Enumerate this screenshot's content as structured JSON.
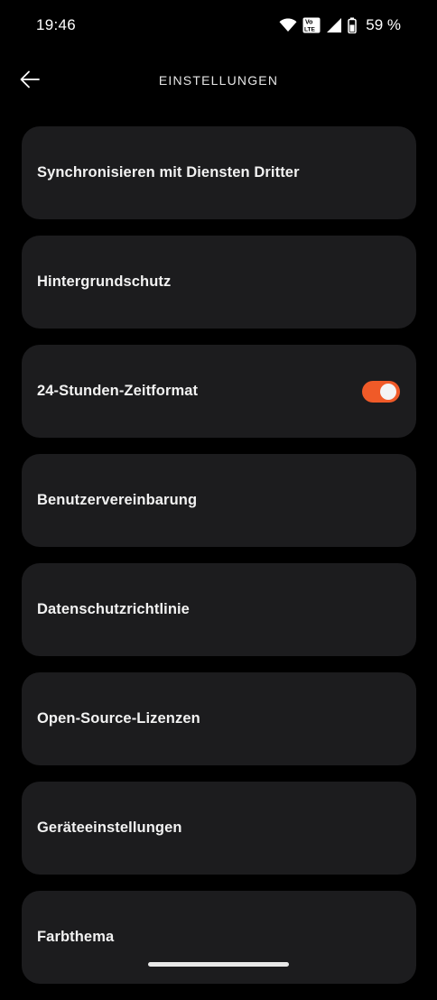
{
  "status_bar": {
    "time": "19:46",
    "battery_percent": "59 %",
    "battery_level": 0.59,
    "icons": [
      "wifi-icon",
      "volte-icon",
      "cellular-signal-icon",
      "battery-icon"
    ],
    "volte_top": "Vo",
    "volte_bottom": "LTE"
  },
  "header": {
    "title": "EINSTELLUNGEN",
    "back_icon": "back-arrow-icon"
  },
  "settings": {
    "items": [
      {
        "label": "Synchronisieren mit Diensten Dritter"
      },
      {
        "label": "Hintergrundschutz"
      },
      {
        "label": "24-Stunden-Zeitformat",
        "toggle": true
      },
      {
        "label": "Benutzervereinbarung"
      },
      {
        "label": "Datenschutzrichtlinie"
      },
      {
        "label": "Open-Source-Lizenzen"
      },
      {
        "label": "Geräteeinstellungen"
      },
      {
        "label": "Farbthema"
      }
    ]
  },
  "colors": {
    "background": "#000000",
    "card": "#1c1c1e",
    "accent": "#f05a28",
    "text": "#f2f2f2"
  }
}
